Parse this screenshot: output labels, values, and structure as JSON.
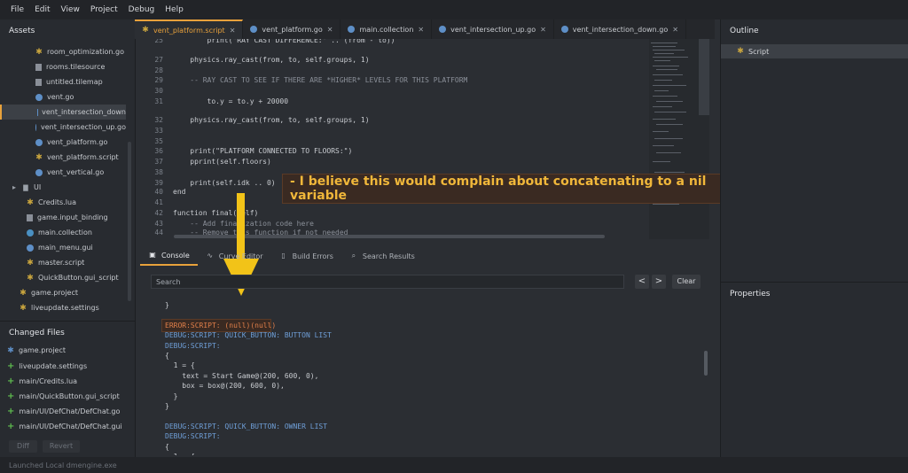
{
  "menu": [
    "File",
    "Edit",
    "View",
    "Project",
    "Debug",
    "Help"
  ],
  "assets": {
    "title": "Assets",
    "items": [
      {
        "label": "room_optimization.go",
        "icon": "gear-icon"
      },
      {
        "label": "rooms.tilesource",
        "icon": "file-icon"
      },
      {
        "label": "untitled.tilemap",
        "icon": "file-icon"
      },
      {
        "label": "vent.go",
        "icon": "gameobject-icon"
      },
      {
        "label": "vent_intersection_down",
        "icon": "gameobject-icon"
      },
      {
        "label": "vent_intersection_up.go",
        "icon": "gameobject-icon"
      },
      {
        "label": "vent_platform.go",
        "icon": "gameobject-icon"
      },
      {
        "label": "vent_platform.script",
        "icon": "gear-icon"
      },
      {
        "label": "vent_vertical.go",
        "icon": "gameobject-icon"
      },
      {
        "label": "UI",
        "icon": "folder-icon"
      },
      {
        "label": "Credits.lua",
        "icon": "gear-icon"
      },
      {
        "label": "game.input_binding",
        "icon": "file-icon"
      },
      {
        "label": "main.collection",
        "icon": "collection-icon"
      },
      {
        "label": "main_menu.gui",
        "icon": "gui-icon"
      },
      {
        "label": "master.script",
        "icon": "gear-icon"
      },
      {
        "label": "QuickButton.gui_script",
        "icon": "gear-icon"
      },
      {
        "label": "game.project",
        "icon": "gear-icon"
      },
      {
        "label": "liveupdate.settings",
        "icon": "gear-icon"
      }
    ]
  },
  "changed": {
    "title": "Changed Files",
    "items": [
      {
        "label": "game.project",
        "icon": "gear-icon"
      },
      {
        "label": "liveupdate.settings",
        "icon": "plus-icon"
      },
      {
        "label": "main/Credits.lua",
        "icon": "plus-icon"
      },
      {
        "label": "main/QuickButton.gui_script",
        "icon": "plus-icon"
      },
      {
        "label": "main/UI/DefChat/DefChat.go",
        "icon": "plus-icon"
      },
      {
        "label": "main/UI/DefChat/DefChat.gui",
        "icon": "plus-icon"
      }
    ],
    "diff_label": "Diff",
    "revert_label": "Revert"
  },
  "tabs": [
    {
      "label": "vent_platform.script",
      "active": true
    },
    {
      "label": "vent_platform.go",
      "active": false
    },
    {
      "label": "main.collection",
      "active": false
    },
    {
      "label": "vent_intersection_up.go",
      "active": false
    },
    {
      "label": "vent_intersection_down.go",
      "active": false
    }
  ],
  "code_lines": [
    {
      "n": "25",
      "t": "        print(\"RAY CAST DIFFERENCE:\" .. (from - to))"
    },
    {
      "n": "27",
      "t": "    physics.ray_cast(from, to, self.groups, 1)"
    },
    {
      "n": "28",
      "t": ""
    },
    {
      "n": "29",
      "t": "    -- RAY CAST TO SEE IF THERE ARE *HIGHER* LEVELS FOR THIS PLATFORM"
    },
    {
      "n": "30",
      "t": ""
    },
    {
      "n": "31",
      "t": "        to.y = to.y + 20000"
    },
    {
      "n": "32",
      "t": "    physics.ray_cast(from, to, self.groups, 1)"
    },
    {
      "n": "33",
      "t": ""
    },
    {
      "n": "35",
      "t": ""
    },
    {
      "n": "36",
      "t": "    print(\"PLATFORM CONNECTED TO FLOORS:\")"
    },
    {
      "n": "37",
      "t": "    pprint(self.floors)"
    },
    {
      "n": "38",
      "t": ""
    },
    {
      "n": "39",
      "t": "    print(self.idk .. 0)"
    },
    {
      "n": "40",
      "t": "end"
    },
    {
      "n": "41",
      "t": ""
    },
    {
      "n": "42",
      "t": "function final(self)"
    },
    {
      "n": "43",
      "t": "    -- Add finalization code here"
    },
    {
      "n": "44",
      "t": "    -- Remove this function if not needed"
    }
  ],
  "annotation": "- I believe this would complain about concatenating to a nil variable",
  "bottom_tabs": [
    {
      "label": "Console",
      "icon": "console-icon",
      "active": true
    },
    {
      "label": "Curve Editor",
      "icon": "curve-icon",
      "active": false
    },
    {
      "label": "Build Errors",
      "icon": "error-icon",
      "active": false
    },
    {
      "label": "Search Results",
      "icon": "search-icon",
      "active": false
    }
  ],
  "search_placeholder": "Search",
  "nav": {
    "prev": "<",
    "next": ">",
    "clear": "Clear"
  },
  "console_lines": [
    {
      "t": "}",
      "k": "plain"
    },
    {
      "t": "",
      "k": "plain"
    },
    {
      "t": "ERROR:SCRIPT: (null)(null)",
      "k": "err"
    },
    {
      "t": "DEBUG:SCRIPT: QUICK_BUTTON: BUTTON LIST",
      "k": "debug"
    },
    {
      "t": "DEBUG:SCRIPT:",
      "k": "debug"
    },
    {
      "t": "{",
      "k": "plain"
    },
    {
      "t": "  1 = {",
      "k": "plain"
    },
    {
      "t": "    text = Start Game@(200, 600, 0),",
      "k": "plain"
    },
    {
      "t": "    box = box@(200, 600, 0),",
      "k": "plain"
    },
    {
      "t": "  }",
      "k": "plain"
    },
    {
      "t": "}",
      "k": "plain"
    },
    {
      "t": "",
      "k": "plain"
    },
    {
      "t": "DEBUG:SCRIPT: QUICK_BUTTON: OWNER LIST",
      "k": "debug"
    },
    {
      "t": "DEBUG:SCRIPT:",
      "k": "debug"
    },
    {
      "t": "{",
      "k": "plain"
    },
    {
      "t": "  1 = {",
      "k": "plain"
    }
  ],
  "outline": {
    "title": "Outline",
    "item": "Script"
  },
  "properties": {
    "title": "Properties"
  },
  "status": "Launched Local dmengine.exe",
  "colors": {
    "accent": "#e8a13b",
    "annotation_text": "#f0b73a",
    "arrow": "#f2c318"
  }
}
